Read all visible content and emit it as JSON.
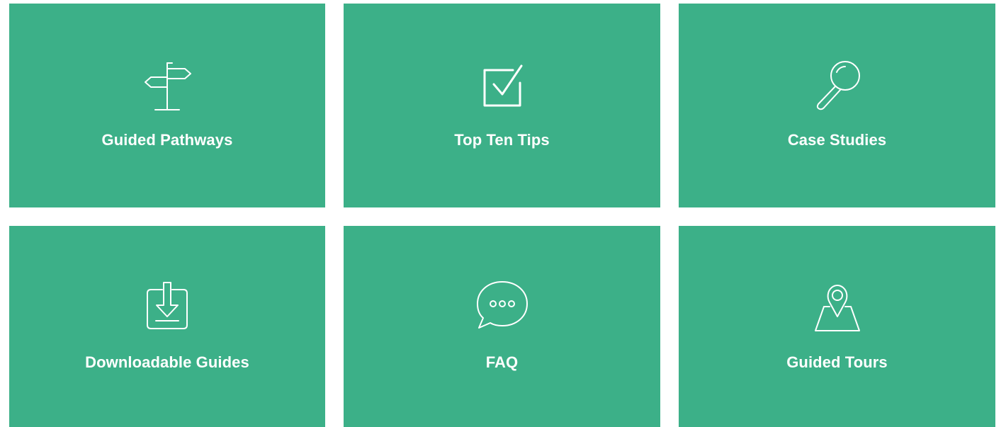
{
  "theme": {
    "tile_color": "#3cb088",
    "text_color": "#ffffff",
    "background": "#ffffff"
  },
  "tiles": [
    {
      "label": "Guided Pathways",
      "icon": "signpost-icon"
    },
    {
      "label": "Top Ten Tips",
      "icon": "checkbox-checked-icon"
    },
    {
      "label": "Case Studies",
      "icon": "magnifying-glass-icon"
    },
    {
      "label": "Downloadable Guides",
      "icon": "download-icon"
    },
    {
      "label": "FAQ",
      "icon": "chat-bubble-icon"
    },
    {
      "label": "Guided Tours",
      "icon": "map-pin-icon"
    }
  ]
}
